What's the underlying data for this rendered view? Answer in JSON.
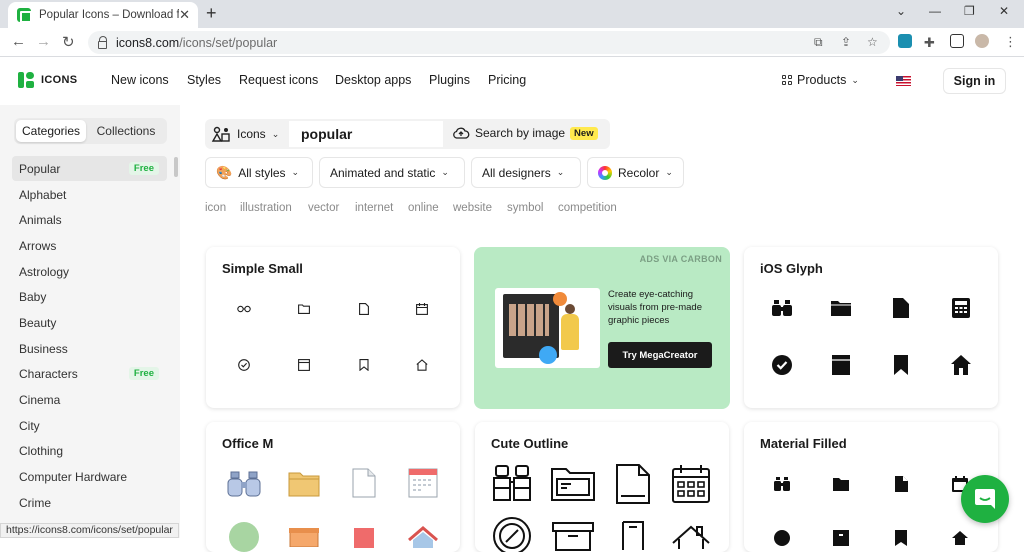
{
  "browser": {
    "tab_title": "Popular Icons – Download for Free",
    "url_host": "icons8.com",
    "url_path": "/icons/set/popular",
    "status_url": "https://icons8.com/icons/set/popular"
  },
  "header": {
    "logo_text": "ICONS",
    "nav": [
      "New icons",
      "Styles",
      "Request icons",
      "Desktop apps",
      "Plugins",
      "Pricing"
    ],
    "products_label": "Products",
    "signin_label": "Sign in"
  },
  "sidebar": {
    "tab_categories": "Categories",
    "tab_collections": "Collections",
    "items": [
      {
        "label": "Popular",
        "badge": "Free"
      },
      {
        "label": "Alphabet",
        "badge": ""
      },
      {
        "label": "Animals",
        "badge": ""
      },
      {
        "label": "Arrows",
        "badge": ""
      },
      {
        "label": "Astrology",
        "badge": ""
      },
      {
        "label": "Baby",
        "badge": ""
      },
      {
        "label": "Beauty",
        "badge": ""
      },
      {
        "label": "Business",
        "badge": ""
      },
      {
        "label": "Characters",
        "badge": "Free"
      },
      {
        "label": "Cinema",
        "badge": ""
      },
      {
        "label": "City",
        "badge": ""
      },
      {
        "label": "Clothing",
        "badge": ""
      },
      {
        "label": "Computer Hardware",
        "badge": ""
      },
      {
        "label": "Crime",
        "badge": ""
      }
    ]
  },
  "search": {
    "type_label": "Icons",
    "query": "popular",
    "image_search_label": "Search by image",
    "new_badge": "New"
  },
  "filters": {
    "styles": "All styles",
    "animation": "Animated and static",
    "designers": "All designers",
    "recolor": "Recolor"
  },
  "tags": [
    "icon",
    "illustration",
    "vector",
    "internet",
    "online",
    "website",
    "symbol",
    "competition"
  ],
  "cards": {
    "simple_small": "Simple Small",
    "ios_glyph": "iOS Glyph",
    "office_m": "Office M",
    "cute_outline": "Cute Outline",
    "material_filled": "Material Filled"
  },
  "ad": {
    "label": "ADS VIA CARBON",
    "text": "Create eye-catching visuals from pre-made graphic pieces",
    "button": "Try MegaCreator"
  },
  "colors": {
    "brand": "#1fb141",
    "ad_bg": "#b9eac4"
  }
}
